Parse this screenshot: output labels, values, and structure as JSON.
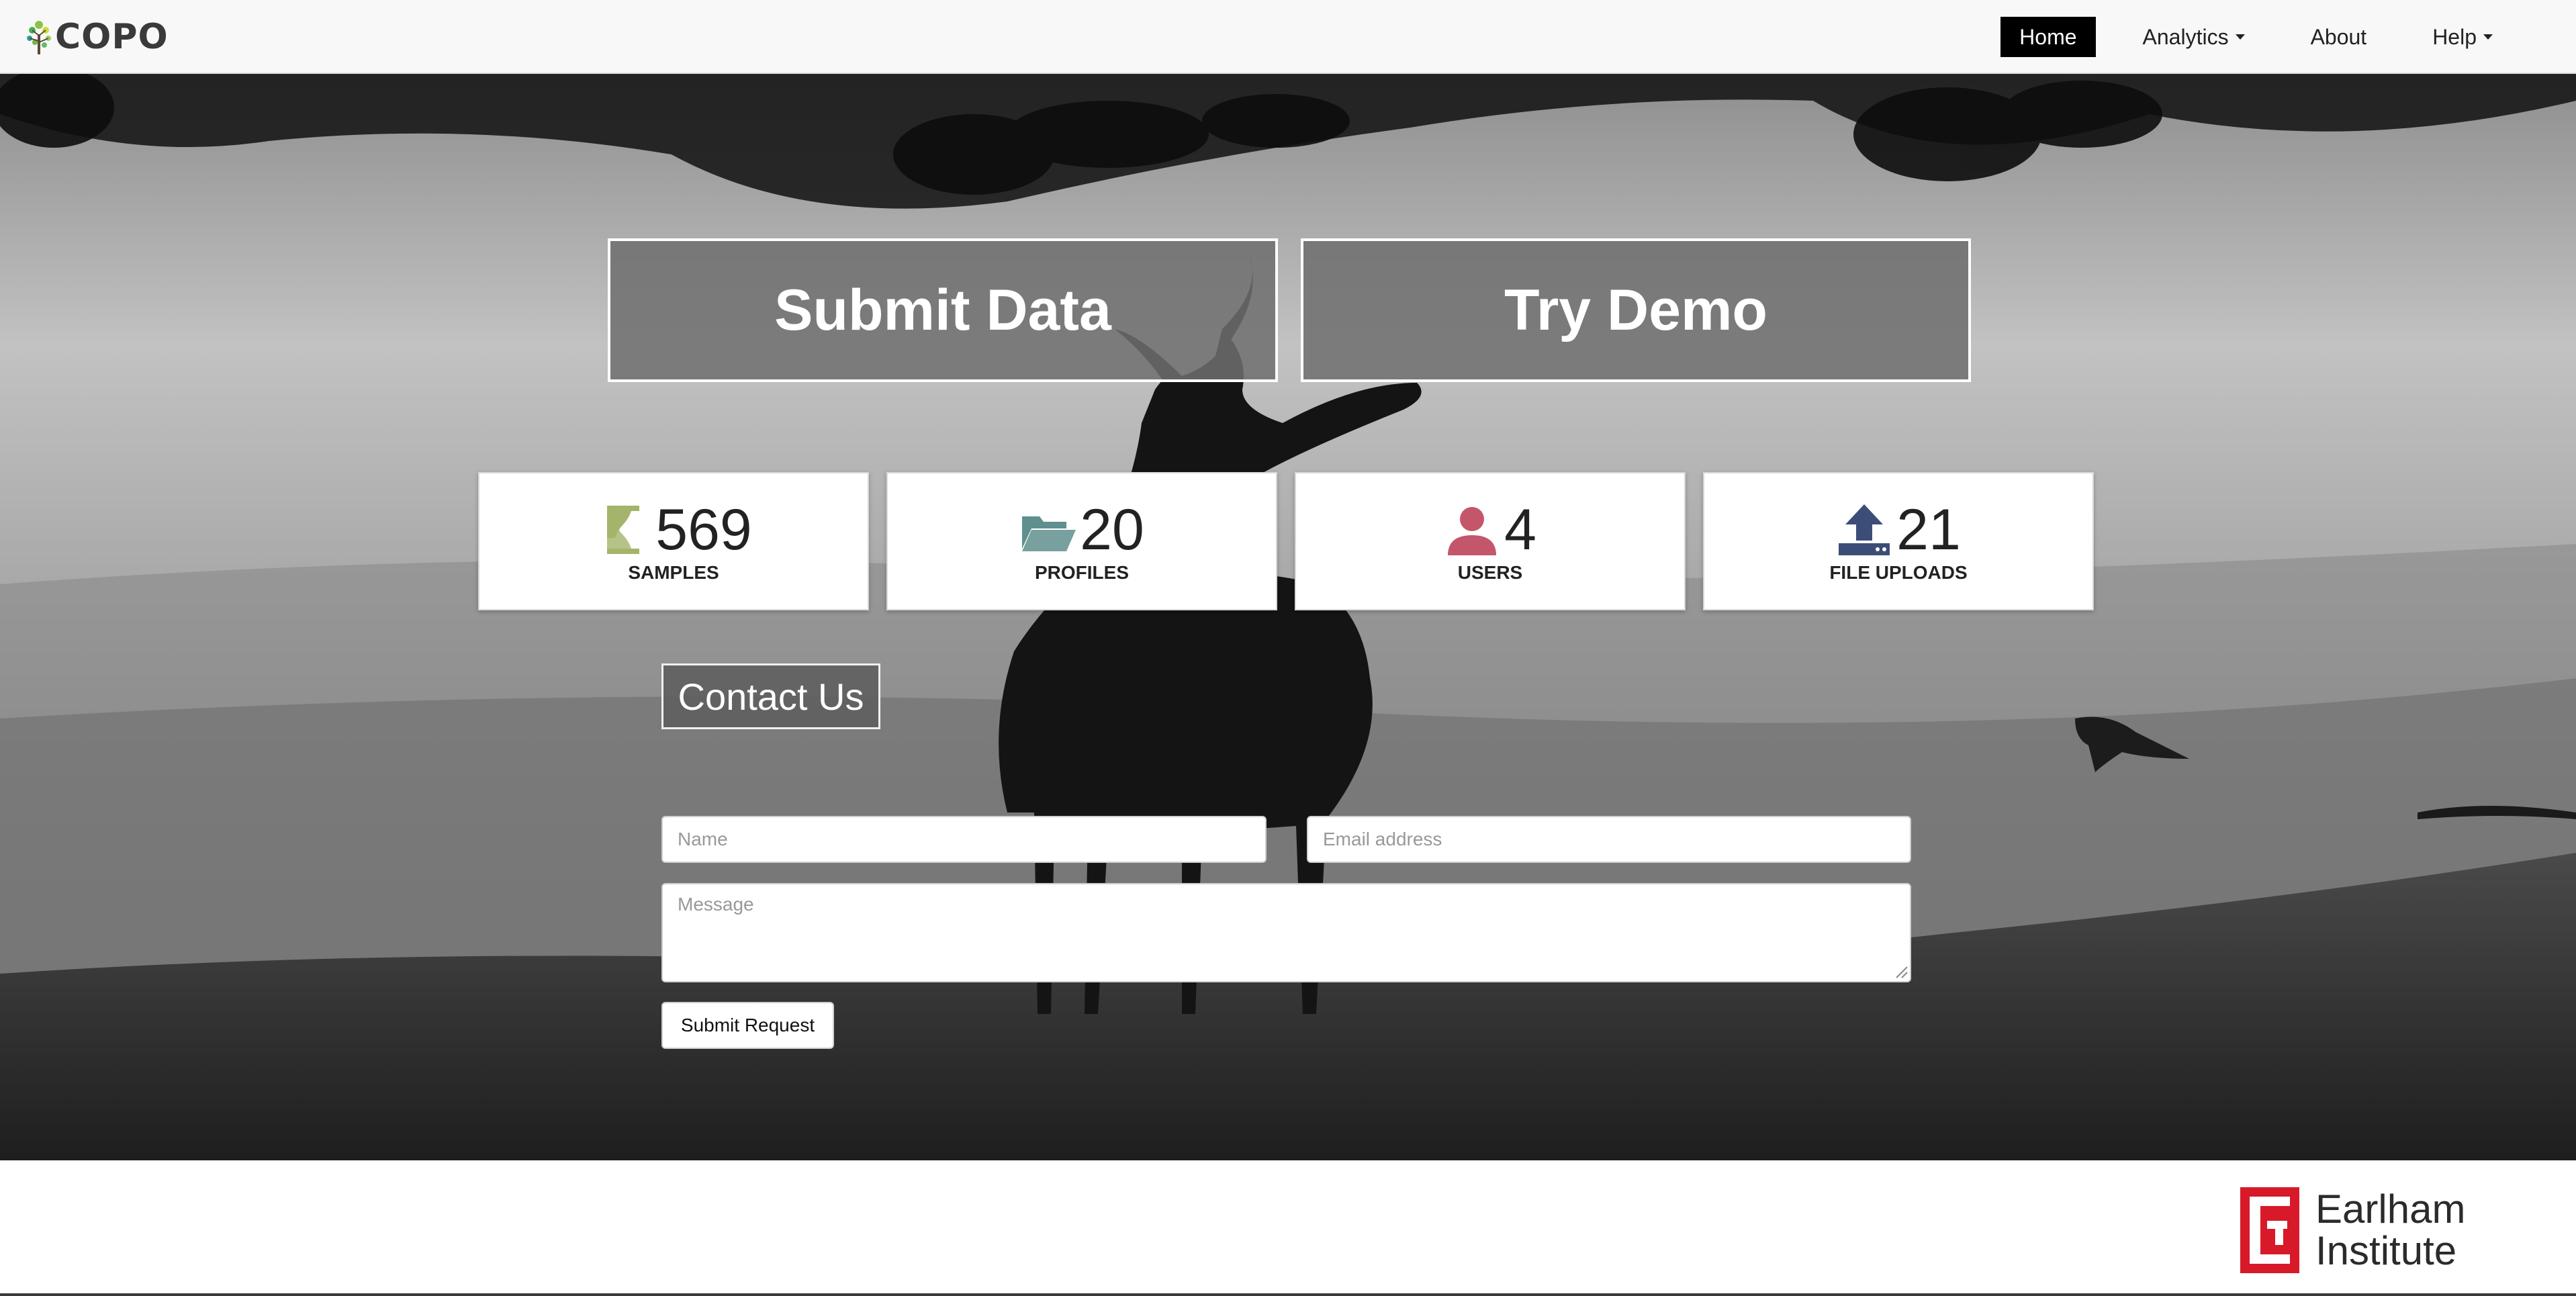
{
  "navbar": {
    "brand": "COPO",
    "items": [
      {
        "label": "Home",
        "active": true,
        "dropdown": false
      },
      {
        "label": "Analytics",
        "active": false,
        "dropdown": true
      },
      {
        "label": "About",
        "active": false,
        "dropdown": false
      },
      {
        "label": "Help",
        "active": false,
        "dropdown": true
      }
    ]
  },
  "hero": {
    "submit_label": "Submit Data",
    "demo_label": "Try Demo",
    "stats": [
      {
        "value": "569",
        "label": "SAMPLES",
        "icon": "dna-icon",
        "color": "#a4b46a"
      },
      {
        "value": "20",
        "label": "PROFILES",
        "icon": "folder-open-icon",
        "color": "#5f8f8e"
      },
      {
        "value": "4",
        "label": "USERS",
        "icon": "user-icon",
        "color": "#c4566b"
      },
      {
        "value": "21",
        "label": "FILE UPLOADS",
        "icon": "upload-icon",
        "color": "#3c4e78"
      }
    ]
  },
  "contact": {
    "title": "Contact Us",
    "name_placeholder": "Name",
    "email_placeholder": "Email address",
    "message_placeholder": "Message",
    "submit_label": "Submit Request"
  },
  "footer": {
    "logo_line1": "Earlham",
    "logo_line2": "Institute",
    "logo_color": "#d7192a"
  }
}
